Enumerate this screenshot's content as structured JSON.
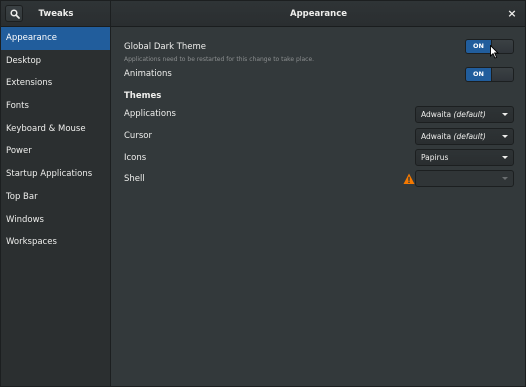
{
  "header": {
    "app_title": "Tweaks",
    "page_title": "Appearance",
    "close_label": "×"
  },
  "sidebar": {
    "items": [
      {
        "label": "Appearance",
        "active": true
      },
      {
        "label": "Desktop"
      },
      {
        "label": "Extensions"
      },
      {
        "label": "Fonts"
      },
      {
        "label": "Keyboard & Mouse"
      },
      {
        "label": "Power"
      },
      {
        "label": "Startup Applications"
      },
      {
        "label": "Top Bar"
      },
      {
        "label": "Windows"
      },
      {
        "label": "Workspaces"
      }
    ]
  },
  "main": {
    "global_dark_theme": {
      "label": "Global Dark Theme",
      "note": "Applications need to be restarted for this change to take place.",
      "switch_label": "ON"
    },
    "animations": {
      "label": "Animations",
      "switch_label": "ON"
    },
    "themes_title": "Themes",
    "themes": [
      {
        "label": "Applications",
        "value": "Adwaita",
        "suffix": "(default)"
      },
      {
        "label": "Cursor",
        "value": "Adwaita",
        "suffix": "(default)"
      },
      {
        "label": "Icons",
        "value": "Papirus",
        "suffix": ""
      },
      {
        "label": "Shell",
        "value": "",
        "suffix": ""
      }
    ]
  },
  "icons": {
    "search": "search-icon",
    "close": "close-icon",
    "warning": "warning-icon",
    "dropdown": "chevron-down-icon"
  },
  "colors": {
    "accent": "#215d9c",
    "warning": "#f57900"
  }
}
